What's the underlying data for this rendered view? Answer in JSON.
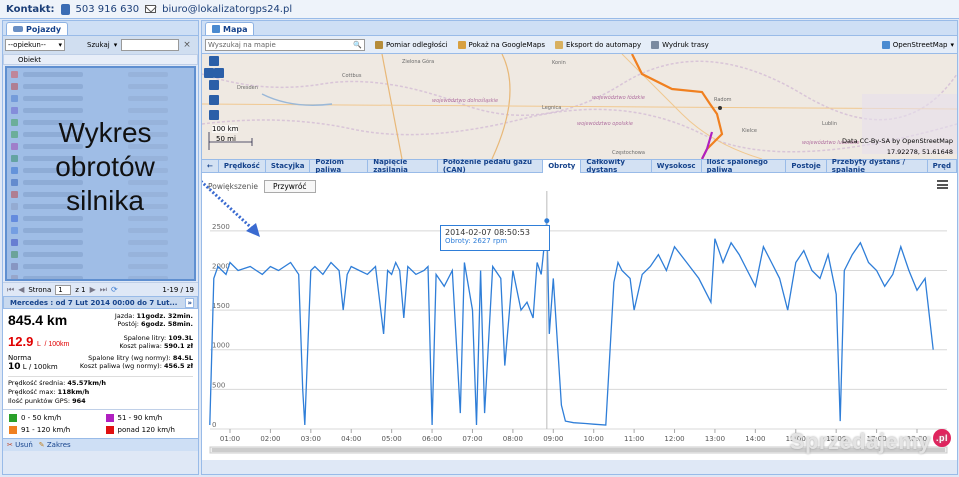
{
  "topbar": {
    "contact_label": "Kontakt:",
    "phone": "503 916 630",
    "email": "biuro@lokalizatorgps24.pl"
  },
  "left": {
    "tab_label": "Pojazdy",
    "filter_select": "--opiekun--",
    "search_label": "Szukaj",
    "grid_header": "Obiekt",
    "row_colors": [
      "#e05050",
      "#c04040",
      "#4a7ad0",
      "#6a5fd0",
      "#3aa050",
      "#3aa050",
      "#a040b0",
      "#2a8a60",
      "#2a6ad0",
      "#2a5ab8",
      "#c04040",
      "#8a9ac0",
      "#2a5ad8",
      "#4a80e0",
      "#3040c0",
      "#3a8a50",
      "#7070a0",
      "#9090b0",
      "#9aa8c8"
    ],
    "overlay_text": [
      "Wykres",
      "obrotów",
      "silnika"
    ],
    "pager": {
      "page_label": "Strona",
      "page_value": "1",
      "of_label": "z 1",
      "range": "1-19 / 19"
    },
    "vehicle_header": "Mercedes : od 7 Lut 2014 00:00 do 7 Lut...",
    "distance": "845.4 km",
    "drive_time_label": "Jazda:",
    "drive_time": "11godz. 32min.",
    "stop_time_label": "Postój:",
    "stop_time": "6godz. 58min.",
    "fuel_value": "12.9",
    "fuel_unit_l": "L",
    "fuel_unit_per": "/ 100km",
    "fuel_used_label": "Spalone litry:",
    "fuel_used": "109.3L",
    "fuel_cost_label": "Koszt paliwa:",
    "fuel_cost": "590.1 zł",
    "norm_label": "Norma",
    "norm_value": "10",
    "norm_unit": "L / 100km",
    "norm_fuel_label": "Spalone litry (wg normy):",
    "norm_fuel": "84.5L",
    "norm_cost_label": "Koszt paliwa (wg normy):",
    "norm_cost": "456.5 zł",
    "avg_speed_label": "Prędkość średnia:",
    "avg_speed": "45.57km/h",
    "max_speed_label": "Prędkość max:",
    "max_speed": "118km/h",
    "gps_points_label": "Ilość punktów GPS:",
    "gps_points": "964",
    "legend": [
      {
        "label": "0 - 50 km/h",
        "color": "#2aa02a"
      },
      {
        "label": "51 - 90 km/h",
        "color": "#b020c0"
      },
      {
        "label": "91 - 120 km/h",
        "color": "#f08020"
      },
      {
        "label": "ponad 120 km/h",
        "color": "#e01010"
      }
    ],
    "bottom_tab_1": "Usuń",
    "bottom_tab_2": "Zakres"
  },
  "right": {
    "tab_label": "Mapa",
    "search_placeholder": "Wyszukaj na mapie",
    "toolbar": [
      "Pomiar odległości",
      "Pokaż na GoogleMaps",
      "Eksport do automapy",
      "Wydruk trasy"
    ],
    "map_provider": "OpenStreetMap",
    "scale_km": "100 km",
    "scale_mi": "50 mi",
    "attribution": "Data CC-By-SA by OpenStreetMap",
    "coords": "17.92278, 51.61648",
    "chart_tabs": [
      "Prędkość",
      "Stacyjka",
      "Poziom paliwa",
      "Napięcie zasilania",
      "Położenie pedału gazu (CAN)",
      "Obroty",
      "Całkowity dystans",
      "Wysokosc",
      "Ilość spalonego paliwa",
      "Postoje",
      "Przebyty dystans / spalanie",
      "Pręd"
    ],
    "active_tab_index": 5,
    "zoom_label": "Powiększenie",
    "reset_label": "Przywróć",
    "tooltip_time": "2014-02-07 08:50:53",
    "tooltip_value": "Obroty: 2627 rpm",
    "watermark": "Sprzedajemy",
    "watermark_badge": ".pl"
  },
  "chart_data": {
    "type": "line",
    "title": "",
    "xlabel": "",
    "ylabel": "",
    "ylim": [
      0,
      2750
    ],
    "yticks": [
      0,
      500,
      1000,
      1500,
      2000,
      2500
    ],
    "xticks": [
      "01:00",
      "02:00",
      "03:00",
      "04:00",
      "05:00",
      "06:00",
      "07:00",
      "08:00",
      "09:00",
      "10:00",
      "11:00",
      "12:00",
      "13:00",
      "14:00",
      "15:00",
      "16:00",
      "17:00",
      "18:00"
    ],
    "series": [
      {
        "name": "",
        "color": "#2f7ed8",
        "x_hours": [
          0.5,
          0.6,
          0.7,
          0.9,
          1.0,
          1.2,
          1.5,
          1.8,
          2.0,
          2.2,
          2.5,
          2.7,
          2.8,
          2.85,
          3.0,
          3.1,
          3.3,
          3.5,
          3.7,
          3.8,
          3.9,
          4.0,
          4.2,
          4.4,
          4.6,
          4.8,
          4.9,
          5.0,
          5.1,
          5.2,
          5.3,
          5.4,
          5.6,
          5.8,
          5.9,
          6.0,
          6.1,
          6.3,
          6.5,
          6.7,
          6.8,
          7.0,
          7.1,
          7.2,
          7.3,
          7.5,
          7.7,
          7.8,
          8.0,
          8.2,
          8.35,
          8.5,
          8.6,
          8.7,
          8.84,
          8.9,
          9.0,
          9.2,
          9.3,
          9.5,
          9.8,
          10.0,
          10.3,
          10.5,
          10.6,
          10.7,
          10.9,
          11.0,
          11.2,
          11.4,
          11.6,
          11.8,
          12.0,
          12.3,
          12.6,
          12.9,
          13.0,
          13.2,
          13.4,
          13.6,
          13.8,
          14.0,
          14.2,
          14.4,
          14.6,
          14.8,
          15.0,
          15.2,
          15.4,
          15.6,
          15.8,
          16.0,
          16.1,
          16.2,
          16.4,
          16.6,
          16.8,
          17.0,
          17.2,
          17.4,
          17.6,
          17.8,
          18.0,
          18.2,
          18.4
        ],
        "values": [
          50,
          1900,
          2050,
          1950,
          2100,
          2000,
          2050,
          1950,
          2050,
          2000,
          2100,
          1950,
          500,
          50,
          2000,
          2050,
          1950,
          2100,
          2000,
          1500,
          1950,
          2050,
          2000,
          1950,
          2050,
          1200,
          2000,
          1950,
          2100,
          2000,
          1400,
          2050,
          1950,
          2000,
          2050,
          50,
          1950,
          1800,
          2000,
          200,
          2100,
          1500,
          50,
          2000,
          200,
          2050,
          1900,
          800,
          2000,
          1500,
          1600,
          1400,
          2100,
          1950,
          2627,
          1200,
          1900,
          300,
          100,
          80,
          70,
          60,
          50,
          1850,
          2100,
          2000,
          1900,
          1500,
          1950,
          2050,
          2200,
          2000,
          2300,
          2100,
          1900,
          1600,
          2400,
          2100,
          2350,
          2200,
          2000,
          1800,
          2300,
          2100,
          1900,
          1500,
          2100,
          2250,
          2000,
          1900,
          2200,
          1700,
          100,
          2000,
          2200,
          2350,
          2100,
          2000,
          1800,
          1950,
          2300,
          2000,
          1750,
          1900,
          1000
        ]
      }
    ]
  }
}
